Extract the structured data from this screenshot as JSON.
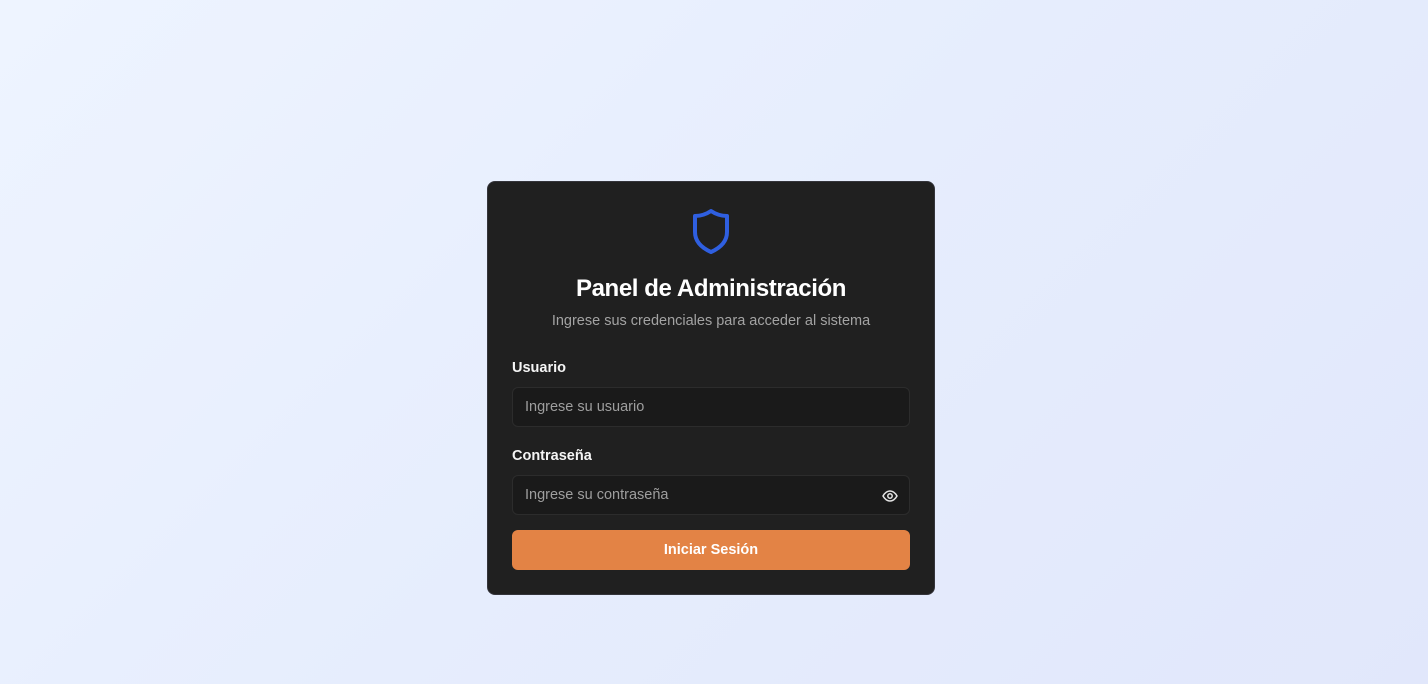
{
  "login": {
    "icon": "shield-icon",
    "title": "Panel de Administración",
    "subtitle": "Ingrese sus credenciales para acceder al sistema",
    "username": {
      "label": "Usuario",
      "value": "",
      "placeholder": "Ingrese su usuario"
    },
    "password": {
      "label": "Contraseña",
      "value": "",
      "placeholder": "Ingrese su contraseña",
      "toggle_icon": "eye-icon"
    },
    "submit_label": "Iniciar Sesión"
  },
  "colors": {
    "accent": "#e38345",
    "shield": "#2f5fe0",
    "card_bg": "#202020",
    "input_bg": "#1a1a1a"
  }
}
